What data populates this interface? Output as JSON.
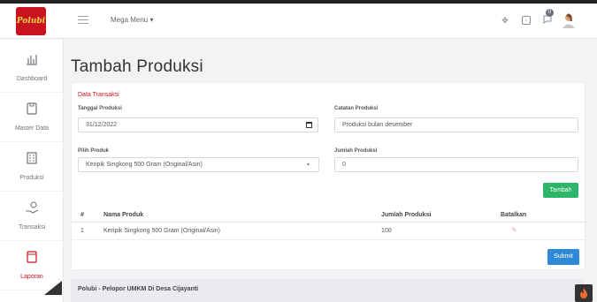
{
  "app": {
    "logo_text": "Polubi"
  },
  "topbar": {
    "mega_menu": "Mega Menu",
    "notification_count": "0"
  },
  "sidebar": {
    "items": [
      {
        "label": "Dashboard",
        "icon": "chart-icon"
      },
      {
        "label": "Master Data",
        "icon": "clipboard-icon"
      },
      {
        "label": "Produksi",
        "icon": "building-icon"
      },
      {
        "label": "Transaksi",
        "icon": "hand-money-icon"
      },
      {
        "label": "Laporan",
        "icon": "report-icon"
      }
    ]
  },
  "page": {
    "title": "Tambah Produksi"
  },
  "form": {
    "section_title": "Data Transaksi",
    "tanggal_label": "Tanggal Produksi",
    "tanggal_value": "31/12/2022",
    "catatan_label": "Catatan Produksi",
    "catatan_value": "Produksi bulan desember",
    "produk_label": "Pilih Produk",
    "produk_value": "Keripik Singkong 500 Gram (Original/Asin)",
    "jumlah_label": "Jumlah Produksi",
    "jumlah_value": "0",
    "add_button": "Tambah",
    "submit_button": "Submit"
  },
  "table": {
    "headers": [
      "#",
      "Nama Produk",
      "Jumlah Produksi",
      "Batalkan"
    ],
    "rows": [
      {
        "no": "1",
        "nama": "Keripik Singkong 500 Gram (Original/Asin)",
        "jumlah": "100"
      }
    ]
  },
  "footer": {
    "text": "Polubi - Pelopor UMKM Di Desa Cijayanti"
  },
  "colors": {
    "brand_red": "#c8141d",
    "green": "#2db56a",
    "blue": "#2f89d6"
  }
}
